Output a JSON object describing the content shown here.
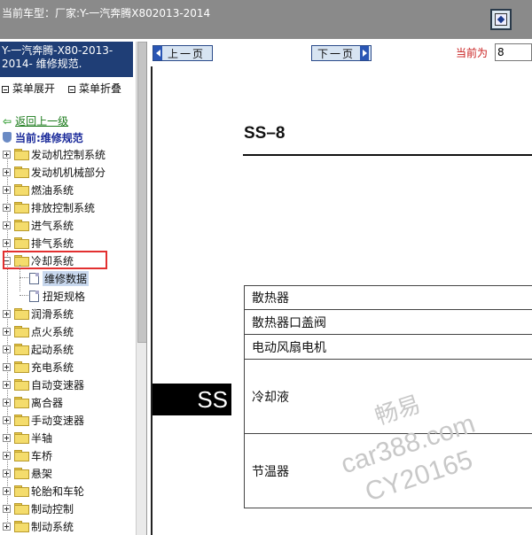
{
  "topbar": {
    "vehicle_label": "当前车型：",
    "vehicle_info": "厂家:Y-一汽奔腾X802013-2014"
  },
  "sidebar": {
    "title": "Y-一汽奔腾-X80-2013-2014- 维修规范.",
    "expand_label": "菜单展开",
    "collapse_label": "菜单折叠",
    "back_label": "返回上一级",
    "current_label": "当前:维修规范",
    "items": [
      {
        "label": "发动机控制系统"
      },
      {
        "label": "发动机机械部分"
      },
      {
        "label": "燃油系统"
      },
      {
        "label": "排放控制系统"
      },
      {
        "label": "进气系统"
      },
      {
        "label": "排气系统"
      },
      {
        "label": "冷却系统"
      },
      {
        "label": "维修数据"
      },
      {
        "label": "扭矩规格"
      },
      {
        "label": "润滑系统"
      },
      {
        "label": "点火系统"
      },
      {
        "label": "起动系统"
      },
      {
        "label": "充电系统"
      },
      {
        "label": "自动变速器"
      },
      {
        "label": "离合器"
      },
      {
        "label": "手动变速器"
      },
      {
        "label": "半轴"
      },
      {
        "label": "车桥"
      },
      {
        "label": "悬架"
      },
      {
        "label": "轮胎和车轮"
      },
      {
        "label": "制动控制"
      },
      {
        "label": "制动系统"
      }
    ]
  },
  "nav": {
    "prev_label": "上一页",
    "next_label": "下一页",
    "current_page_label": "当前为",
    "current_page_value": "8"
  },
  "document": {
    "page_code": "SS–8",
    "section_tab": "SS",
    "rows": [
      "散热器",
      "散热器口盖阀",
      "电动风扇电机",
      "冷却液",
      "节温器"
    ]
  },
  "watermark": {
    "line1": "畅易",
    "line2": "car388.com",
    "line3": "CY20165"
  }
}
